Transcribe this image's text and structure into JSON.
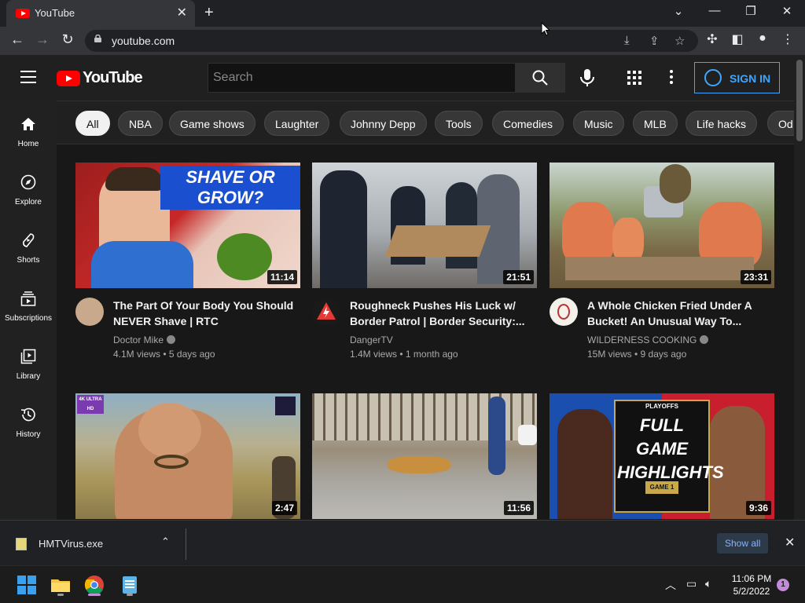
{
  "browser": {
    "tab_title": "YouTube",
    "tab_close": "✕",
    "new_tab": "+",
    "url": "youtube.com",
    "window_controls": {
      "minimize": "—",
      "restore": "❐",
      "close": "✕",
      "tab_search": "⌄"
    }
  },
  "header": {
    "logo_text": "YouTube",
    "search_placeholder": "Search",
    "sign_in": "SIGN IN"
  },
  "chips": [
    "All",
    "NBA",
    "Game shows",
    "Laughter",
    "Johnny Depp",
    "Tools",
    "Comedies",
    "Music",
    "MLB",
    "Life hacks",
    "Od"
  ],
  "guide": [
    {
      "label": "Home",
      "icon": "home-icon"
    },
    {
      "label": "Explore",
      "icon": "compass-icon"
    },
    {
      "label": "Shorts",
      "icon": "shorts-icon"
    },
    {
      "label": "Subscriptions",
      "icon": "subscriptions-icon"
    },
    {
      "label": "Library",
      "icon": "library-icon"
    },
    {
      "label": "History",
      "icon": "history-icon"
    }
  ],
  "videos": [
    {
      "title": "The Part Of Your Body You Should NEVER Shave | RTC",
      "channel": "Doctor Mike",
      "verified": true,
      "meta": "4.1M views • 5 days ago",
      "duration": "11:14",
      "thumb_text": "SHAVE OR GROW?"
    },
    {
      "title": "Roughneck Pushes His Luck w/ Border Patrol | Border Security:...",
      "channel": "DangerTV",
      "verified": false,
      "meta": "1.4M views • 1 month ago",
      "duration": "21:51"
    },
    {
      "title": "A Whole Chicken Fried Under A Bucket! An Unusual Way To...",
      "channel": "WILDERNESS COOKING",
      "verified": true,
      "meta": "15M views • 9 days ago",
      "duration": "23:31"
    },
    {
      "title": "",
      "channel": "",
      "meta": "",
      "duration": "2:47",
      "thumb_badge": "4K ULTRA HD"
    },
    {
      "title": "",
      "channel": "",
      "meta": "",
      "duration": "11:56"
    },
    {
      "title": "",
      "channel": "",
      "meta": "",
      "duration": "9:36",
      "thumb_text": "FULL GAME HIGHLIGHTS",
      "thumb_small": "PLAYOFFS",
      "thumb_game": "GAME 1"
    }
  ],
  "download": {
    "filename": "HMTVirus.exe",
    "show_all": "Show all"
  },
  "taskbar": {
    "time": "11:06 PM",
    "date": "5/2/2022",
    "notifications": "1"
  }
}
